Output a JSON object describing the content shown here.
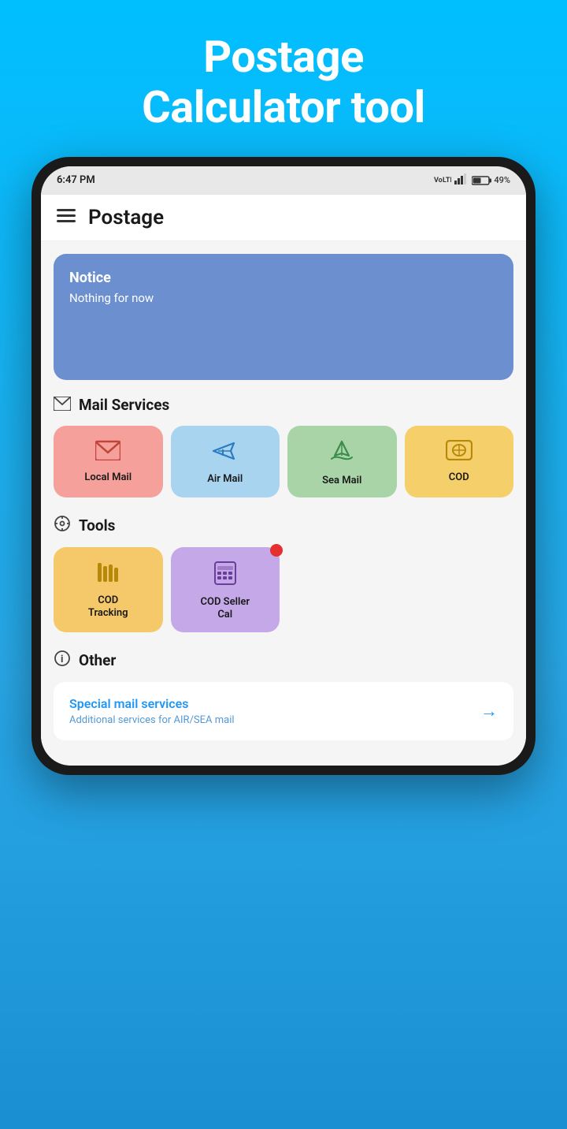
{
  "app_title_line1": "Postage",
  "app_title_line2": "Calculator tool",
  "status_bar": {
    "time": "6:47 PM",
    "signal": "4G LTE",
    "battery_percent": "49%"
  },
  "header": {
    "title": "Postage"
  },
  "notice": {
    "title": "Notice",
    "body": "Nothing for now"
  },
  "mail_services": {
    "section_label": "Mail Services",
    "items": [
      {
        "id": "local-mail",
        "label": "Local Mail",
        "color_class": "local-mail"
      },
      {
        "id": "air-mail",
        "label": "Air Mail",
        "color_class": "air-mail"
      },
      {
        "id": "sea-mail",
        "label": "Sea Mail",
        "color_class": "sea-mail"
      },
      {
        "id": "cod",
        "label": "COD",
        "color_class": "cod"
      }
    ]
  },
  "tools": {
    "section_label": "Tools",
    "items": [
      {
        "id": "cod-tracking",
        "label": "COD\nTracking",
        "label_line1": "COD",
        "label_line2": "Tracking",
        "color_class": "cod-tracking",
        "has_notification": false
      },
      {
        "id": "cod-seller-cal",
        "label": "COD Seller\nCal",
        "label_line1": "COD Seller",
        "label_line2": "Cal",
        "color_class": "cod-seller",
        "has_notification": true
      }
    ]
  },
  "other": {
    "section_label": "Other",
    "special_mail": {
      "title": "Special mail services",
      "subtitle": "Additional services for AIR/SEA mail"
    }
  }
}
